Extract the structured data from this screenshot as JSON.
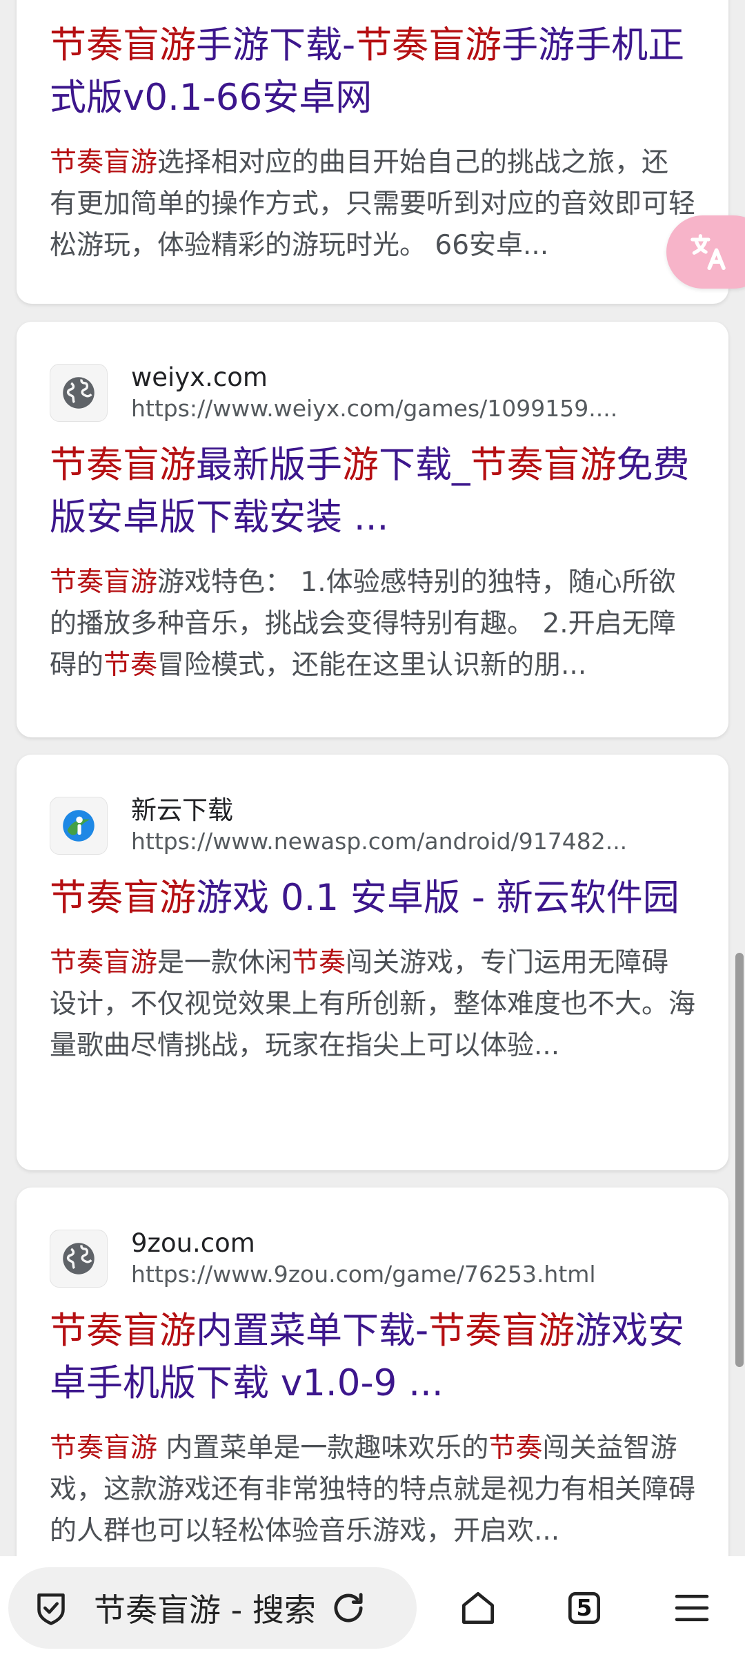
{
  "results": [
    {
      "title_parts": [
        {
          "text": "节奏盲游",
          "hl": true
        },
        {
          "text": "手游下载-",
          "hl": false
        },
        {
          "text": "节奏盲游",
          "hl": true
        },
        {
          "text": "手游手机正式版v0.1-66安卓网",
          "hl": false
        }
      ],
      "snippet_parts": [
        {
          "text": "节奏盲游",
          "hl": true
        },
        {
          "text": "选择相对应的曲目开始自己的挑战之旅，还有更加简单的操作方式，只需要听到对应的音效即可轻松游玩，体验精彩的游玩时光。 66安卓...",
          "hl": false
        }
      ]
    },
    {
      "site_name": "weiyx.com",
      "site_url": "https://www.weiyx.com/games/1099159....",
      "icon": "globe-icon",
      "title_parts": [
        {
          "text": "节奏盲游",
          "hl": true
        },
        {
          "text": "最新版手",
          "hl": false
        },
        {
          "text": "游",
          "hl": true
        },
        {
          "text": "下载_",
          "hl": false
        },
        {
          "text": "节奏盲游",
          "hl": true
        },
        {
          "text": "免费版安卓版下载安装 ...",
          "hl": false
        }
      ],
      "snippet_parts": [
        {
          "text": "节奏盲游",
          "hl": true
        },
        {
          "text": "游戏特色： 1.体验感特别的独特，随心所欲的播放多种音乐，挑战会变得特别有趣。 2.开启无障碍的",
          "hl": false
        },
        {
          "text": "节奏",
          "hl": true
        },
        {
          "text": "冒险模式，还能在这里认识新的朋...",
          "hl": false
        }
      ]
    },
    {
      "site_name": "新云下载",
      "site_url": "https://www.newasp.com/android/917482...",
      "icon": "newasp-logo-icon",
      "title_parts": [
        {
          "text": "节奏盲游",
          "hl": true
        },
        {
          "text": "游戏 0.1 安卓版 - 新云软件园",
          "hl": false
        }
      ],
      "snippet_parts": [
        {
          "text": "节奏盲游",
          "hl": true
        },
        {
          "text": "是一款休闲",
          "hl": false
        },
        {
          "text": "节奏",
          "hl": true
        },
        {
          "text": "闯关游戏，专门运用无障碍设计，不仅视觉效果上有所创新，整体难度也不大。海量歌曲尽情挑战，玩家在指尖上可以体验...",
          "hl": false
        }
      ]
    },
    {
      "site_name": "9zou.com",
      "site_url": "https://www.9zou.com/game/76253.html",
      "icon": "globe-icon",
      "title_parts": [
        {
          "text": "节奏盲游",
          "hl": true
        },
        {
          "text": "内置菜单下载-",
          "hl": false
        },
        {
          "text": "节奏盲游",
          "hl": true
        },
        {
          "text": "游戏安卓手机版下载 v1.0-9 ...",
          "hl": false
        }
      ],
      "snippet_parts": [
        {
          "text": "节奏盲游",
          "hl": true
        },
        {
          "text": " 内置菜单是一款趣味欢乐的",
          "hl": false
        },
        {
          "text": "节奏",
          "hl": true
        },
        {
          "text": "闯关益智游戏，这款游戏还有非常独特的特点就是视力有相关障碍的人群也可以轻松体验音乐游戏，开启欢...",
          "hl": false
        }
      ]
    }
  ],
  "bottom_bar": {
    "search_label": "节奏盲游 - 搜索",
    "tab_count": "5"
  },
  "colors": {
    "title": "#3c168c",
    "highlight": "#b50f12",
    "snippet": "#4d5156",
    "translate_button": "#f7b4c9"
  }
}
